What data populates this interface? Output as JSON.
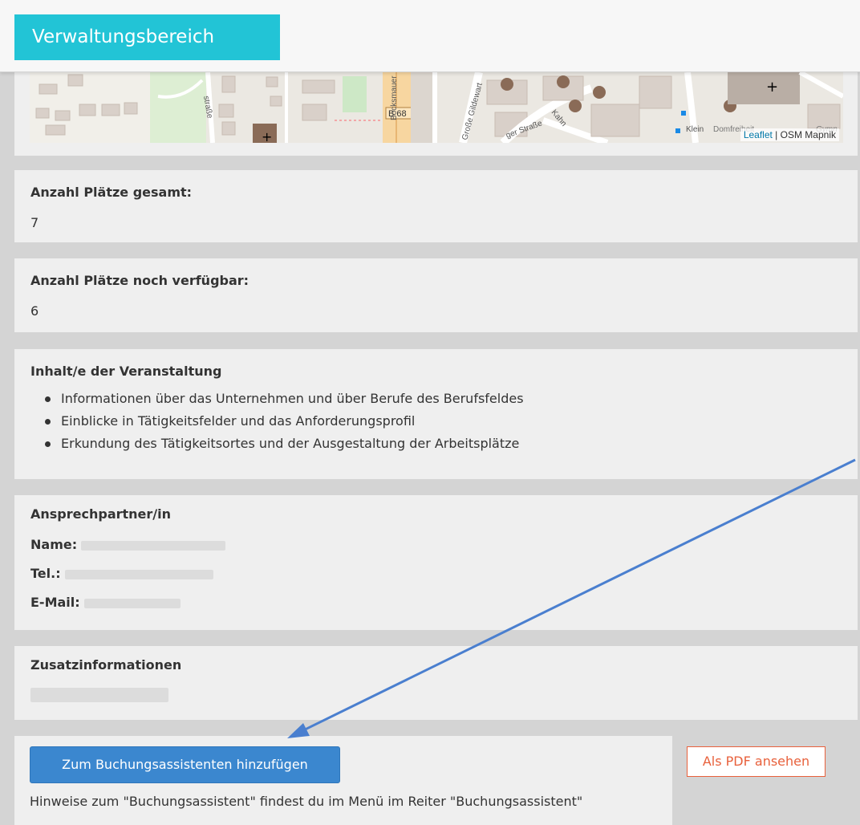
{
  "header": {
    "title": "Verwaltungsbereich"
  },
  "map": {
    "labels": [
      "B 68",
      "Bocksmauer",
      "Große Gildewart",
      "ger Straße",
      "Kahn",
      "straße",
      "Klein",
      "Domfreiheit",
      "Gymn"
    ],
    "attribution_link": "Leaflet",
    "attribution_separator": " | ",
    "attribution_text": "OSM Mapnik"
  },
  "places_total": {
    "label": "Anzahl Plätze gesamt:",
    "value": "7"
  },
  "places_available": {
    "label": "Anzahl Plätze noch verfügbar:",
    "value": "6"
  },
  "content": {
    "title": "Inhalt/e der Veranstaltung",
    "items": [
      "Informationen über das Unternehmen und über Berufe des Berufsfeldes",
      "Einblicke in Tätigkeitsfelder und das Anforderungsprofil",
      "Erkundung des Tätigkeitsortes und der Ausgestaltung der Arbeitsplätze"
    ]
  },
  "contact": {
    "title": "Ansprechpartner/in",
    "name_label": "Name:",
    "tel_label": "Tel.:",
    "email_label": "E-Mail:"
  },
  "extra": {
    "title": "Zusatzinformationen"
  },
  "actions": {
    "book_button": "Zum Buchungsassistenten hinzufügen",
    "pdf_button": "Als PDF ansehen",
    "hint": "Hinweise zum \"Buchungsassistent\" findest du im Menü im Reiter \"Buchungsassistent\""
  },
  "colors": {
    "header_accent": "#22c4d6",
    "primary_button": "#3b87cf",
    "pdf_button": "#e8613c",
    "arrow": "#4a7fcf"
  }
}
